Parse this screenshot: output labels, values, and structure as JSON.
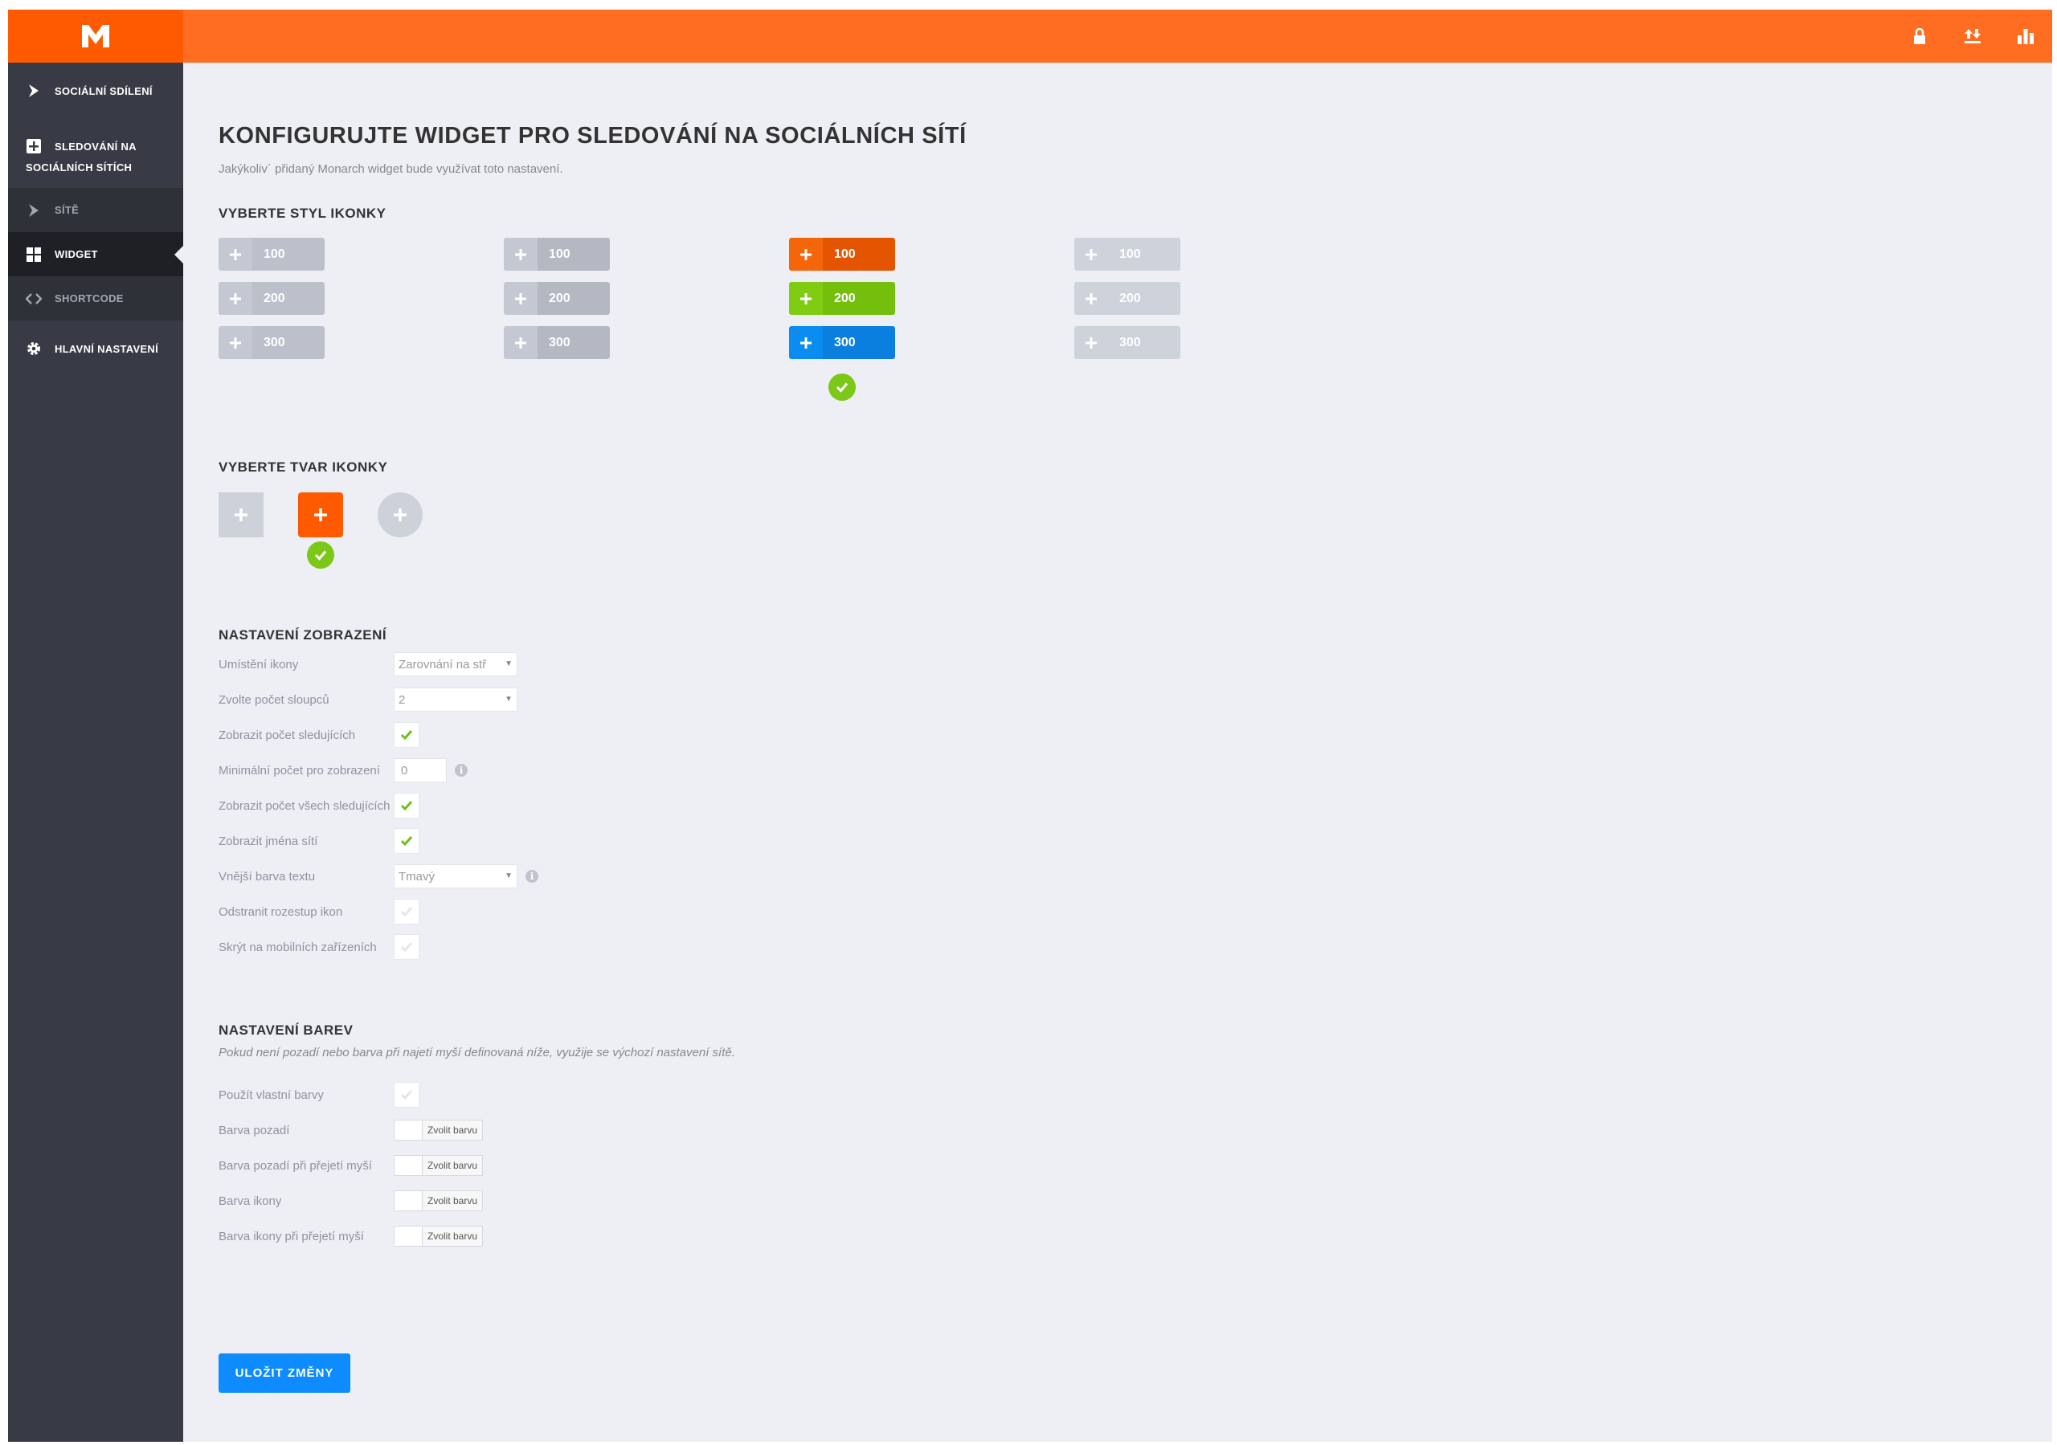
{
  "topbar": {
    "logo": "M",
    "icons": [
      "lock-icon",
      "import-export-icon",
      "stats-icon"
    ]
  },
  "sidebar": {
    "items": [
      {
        "label": "SOCIÁLNÍ SDÍLENÍ",
        "icon": "share-icon"
      },
      {
        "label_line1": "SLEDOVÁNÍ NA",
        "label_line2": "SOCIÁLNÍCH SÍTÍCH",
        "icon": "plus-square-icon"
      },
      {
        "label": "SÍTĚ",
        "icon": "networks-icon"
      },
      {
        "label": "WIDGET",
        "icon": "widget-grid-icon",
        "active": true
      },
      {
        "label": "SHORTCODE",
        "icon": "code-icon"
      },
      {
        "label": "HLAVNÍ NASTAVENÍ",
        "icon": "gear-icon"
      }
    ]
  },
  "page": {
    "title": "KONFIGURUJTE WIDGET PRO SLEDOVÁNÍ NA SOCIÁLNÍCH SÍTÍ",
    "subtitle": "Jakýkoliv´ přidaný Monarch widget bude využívat toto nastavení."
  },
  "icon_style": {
    "title": "VYBERTE STYL IKONKY",
    "selected_index": 2,
    "options": [
      {
        "values": [
          "100",
          "200",
          "300"
        ]
      },
      {
        "values": [
          "100",
          "200",
          "300"
        ]
      },
      {
        "values": [
          "100",
          "200",
          "300"
        ]
      },
      {
        "values": [
          "100",
          "200",
          "300"
        ]
      }
    ]
  },
  "icon_shape": {
    "title": "VYBERTE TVAR IKONKY",
    "selected_index": 1,
    "options": [
      "square",
      "rounded",
      "circle"
    ]
  },
  "display": {
    "title": "NASTAVENÍ ZOBRAZENÍ",
    "icon_placement_label": "Umístění ikony",
    "icon_placement_value": "Zarovnání na stř",
    "columns_label": "Zvolte počet sloupců",
    "columns_value": "2",
    "show_follower_count_label": "Zobrazit počet sledujících",
    "show_follower_count": true,
    "min_count_label": "Minimální počet pro zobrazení",
    "min_count_value": "0",
    "show_total_label": "Zobrazit počet všech sledujících",
    "show_total": true,
    "show_network_names_label": "Zobrazit jména sítí",
    "show_network_names": true,
    "outer_text_color_label": "Vnější barva textu",
    "outer_text_color_value": "Tmavý",
    "remove_spacing_label": "Odstranit rozestup ikon",
    "remove_spacing": false,
    "hide_mobile_label": "Skrýt na mobilních zařízeních",
    "hide_mobile": false,
    "info_glyph": "i"
  },
  "colors": {
    "title": "NASTAVENÍ BAREV",
    "note": "Pokud není pozadí nebo barva při najetí myší definovaná níže, využije se výchozí nastavení sítě.",
    "custom_colors_label": "Použít vlastní barvy",
    "custom_colors": false,
    "pick_label": "Zvolit barvu",
    "bg_label": "Barva pozadí",
    "bg_hover_label": "Barva pozadí při přejetí myší",
    "icon_label": "Barva ikony",
    "icon_hover_label": "Barva ikony při přejetí myší"
  },
  "save_label": "ULOŽIT ZMĚNY",
  "palette": {
    "accent": "#ff6d23",
    "accent_dark": "#ff5a00",
    "green": "#7cc818",
    "blue": "#0d8bff",
    "sidebar": "#383b45"
  }
}
